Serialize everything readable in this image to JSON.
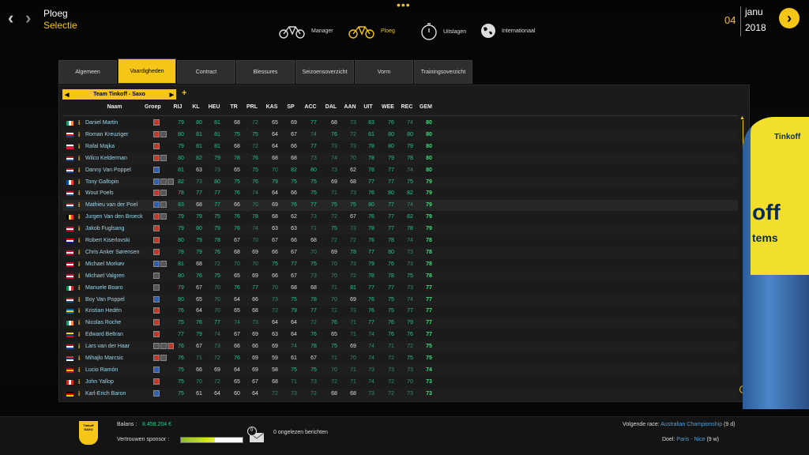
{
  "header": {
    "title": "Ploeg",
    "subtitle": "Selectie",
    "nav": [
      {
        "label": "Manager",
        "icon": "bike-icon"
      },
      {
        "label": "Ploeg",
        "icon": "team-bike-icon",
        "active": true
      },
      {
        "label": "Uitslagen",
        "icon": "stopwatch-icon"
      },
      {
        "label": "Internationaal",
        "icon": "globe-icon"
      }
    ],
    "date_day": "04",
    "date_month": "janu",
    "date_year": "2018"
  },
  "tabs": [
    "Algemeen",
    "Vaardigheden",
    "Contract",
    "Blessures",
    "Seizoensoverzicht",
    "Vorm",
    "Trainingsoverzicht"
  ],
  "active_tab": "Vaardigheden",
  "team": "Team Tinkoff - Saxo",
  "columns": [
    "Naam",
    "Groep",
    "RIJ",
    "KL",
    "HEU",
    "TR",
    "PRL",
    "KAS",
    "SP",
    "ACC",
    "DAL",
    "AAN",
    "UIT",
    "WEE",
    "REC",
    "GEM"
  ],
  "riders": [
    {
      "name": "Daniel Martin",
      "flag": "ie",
      "groups": [
        "r"
      ],
      "stats": [
        79,
        80,
        81,
        68,
        72,
        65,
        69,
        77,
        68,
        73,
        83,
        76,
        74,
        80
      ]
    },
    {
      "name": "Roman Kreuziger",
      "flag": "cz",
      "groups": [
        "r",
        "w"
      ],
      "stats": [
        80,
        81,
        81,
        75,
        75,
        64,
        67,
        74,
        76,
        72,
        81,
        80,
        80,
        80
      ]
    },
    {
      "name": "Rafal Majka",
      "flag": "pl",
      "groups": [
        "r"
      ],
      "stats": [
        79,
        81,
        81,
        68,
        72,
        64,
        66,
        77,
        73,
        73,
        78,
        80,
        79,
        80
      ]
    },
    {
      "name": "Wilco Kelderman",
      "flag": "nl",
      "groups": [
        "r",
        "w"
      ],
      "stats": [
        80,
        82,
        79,
        78,
        76,
        68,
        68,
        73,
        74,
        70,
        78,
        79,
        78,
        80
      ]
    },
    {
      "name": "Danny Van Poppel",
      "flag": "nl",
      "groups": [
        "b"
      ],
      "stats": [
        81,
        63,
        73,
        65,
        75,
        70,
        82,
        80,
        73,
        62,
        78,
        77,
        74,
        80
      ]
    },
    {
      "name": "Tony Gallopin",
      "flag": "fr",
      "groups": [
        "b",
        "w",
        "w"
      ],
      "stats": [
        82,
        73,
        80,
        75,
        76,
        79,
        75,
        75,
        69,
        68,
        77,
        77,
        75,
        79
      ]
    },
    {
      "name": "Wout Poels",
      "flag": "nl",
      "groups": [
        "r",
        "w"
      ],
      "stats": [
        78,
        77,
        77,
        76,
        74,
        64,
        66,
        75,
        71,
        73,
        76,
        80,
        82,
        79
      ]
    },
    {
      "name": "Mathieu van der Poel",
      "flag": "nl",
      "groups": [
        "b",
        "w"
      ],
      "stats": [
        83,
        68,
        77,
        66,
        70,
        69,
        76,
        77,
        75,
        75,
        80,
        77,
        74,
        79
      ]
    },
    {
      "name": "Jurgen Van den Broeck",
      "flag": "be",
      "groups": [
        "r",
        "w"
      ],
      "stats": [
        79,
        79,
        75,
        76,
        78,
        68,
        62,
        73,
        72,
        67,
        76,
        77,
        82,
        79
      ]
    },
    {
      "name": "Jakob Fuglsang",
      "flag": "dk",
      "groups": [
        "r"
      ],
      "stats": [
        79,
        80,
        79,
        76,
        74,
        63,
        63,
        71,
        75,
        73,
        78,
        77,
        78,
        79
      ]
    },
    {
      "name": "Robert Kiserlovski",
      "flag": "hr",
      "groups": [
        "r"
      ],
      "stats": [
        80,
        79,
        78,
        67,
        70,
        67,
        66,
        68,
        72,
        72,
        76,
        78,
        74,
        78
      ]
    },
    {
      "name": "Chris Anker Sørensen",
      "flag": "dk",
      "groups": [
        "r"
      ],
      "stats": [
        78,
        79,
        76,
        68,
        69,
        66,
        67,
        70,
        69,
        78,
        77,
        80,
        73,
        78
      ]
    },
    {
      "name": "Michael Morkøv",
      "flag": "dk",
      "groups": [
        "b",
        "w"
      ],
      "stats": [
        81,
        68,
        72,
        70,
        70,
        75,
        77,
        75,
        70,
        73,
        79,
        76,
        73,
        78
      ]
    },
    {
      "name": "Michael Valgren",
      "flag": "dk",
      "groups": [
        "w"
      ],
      "stats": [
        80,
        76,
        75,
        65,
        69,
        66,
        67,
        73,
        70,
        72,
        78,
        78,
        75,
        78
      ]
    },
    {
      "name": "Manuele Boaro",
      "flag": "it",
      "groups": [
        "w"
      ],
      "stats": [
        79,
        67,
        70,
        76,
        77,
        70,
        68,
        68,
        71,
        81,
        77,
        77,
        73,
        77
      ]
    },
    {
      "name": "Boy Van Poppel",
      "flag": "nl",
      "groups": [
        "b"
      ],
      "stats": [
        80,
        65,
        70,
        64,
        66,
        73,
        75,
        78,
        70,
        69,
        76,
        75,
        74,
        77
      ]
    },
    {
      "name": "Kristian Hedén",
      "flag": "se",
      "groups": [
        "r"
      ],
      "stats": [
        76,
        64,
        70,
        65,
        68,
        72,
        79,
        77,
        72,
        73,
        76,
        75,
        77,
        77
      ]
    },
    {
      "name": "Nicolas Roche",
      "flag": "ie",
      "groups": [
        "r"
      ],
      "stats": [
        75,
        76,
        77,
        74,
        73,
        64,
        64,
        72,
        76,
        71,
        77,
        76,
        79,
        77
      ]
    },
    {
      "name": "Edward Beltran",
      "flag": "co",
      "groups": [
        "r"
      ],
      "stats": [
        77,
        79,
        74,
        67,
        69,
        63,
        64,
        76,
        65,
        71,
        74,
        76,
        76,
        77
      ]
    },
    {
      "name": "Lars van der Haar",
      "flag": "nl",
      "groups": [
        "w",
        "w",
        "r"
      ],
      "stats": [
        76,
        67,
        73,
        66,
        66,
        69,
        74,
        78,
        75,
        69,
        74,
        71,
        72,
        75
      ]
    },
    {
      "name": "Mihajlo Marcsic",
      "flag": "rs",
      "groups": [
        "r",
        "w"
      ],
      "stats": [
        76,
        71,
        72,
        76,
        69,
        59,
        61,
        67,
        71,
        70,
        74,
        72,
        75,
        75
      ]
    },
    {
      "name": "Lucio Ramón",
      "flag": "es",
      "groups": [
        "b"
      ],
      "stats": [
        75,
        66,
        69,
        64,
        69,
        58,
        75,
        75,
        70,
        71,
        73,
        73,
        73,
        74
      ]
    },
    {
      "name": "John Yallop",
      "flag": "ca",
      "groups": [
        "r"
      ],
      "stats": [
        75,
        70,
        72,
        65,
        67,
        68,
        71,
        73,
        72,
        71,
        74,
        72,
        70,
        73
      ]
    },
    {
      "name": "Karl-Erich Baron",
      "flag": "de",
      "groups": [
        "b"
      ],
      "stats": [
        75,
        61,
        64,
        60,
        64,
        72,
        73,
        72,
        68,
        68,
        73,
        72,
        73,
        73
      ]
    }
  ],
  "footer": {
    "balance_label": "Balans :",
    "balance": "8.458.204 €",
    "sponsor_label": "Vertrouwen sponsor :",
    "sponsor_trust": 0.55,
    "msg_count": "0",
    "msg_text": "0 ongelezen berichten",
    "next_race_label": "Volgende race:",
    "next_race": "Australian Championship",
    "next_race_days": "(9 d)",
    "goal_label": "Doel:",
    "goal": "Paris - Nice",
    "goal_weeks": "(9 w)",
    "logo_text": "Tinkoff SAXO"
  },
  "colors": {
    "accent": "#f5c518",
    "stat_hi": "#1fc98a",
    "stat_lo": "#2f8f6c",
    "name": "#9fd6e6"
  }
}
